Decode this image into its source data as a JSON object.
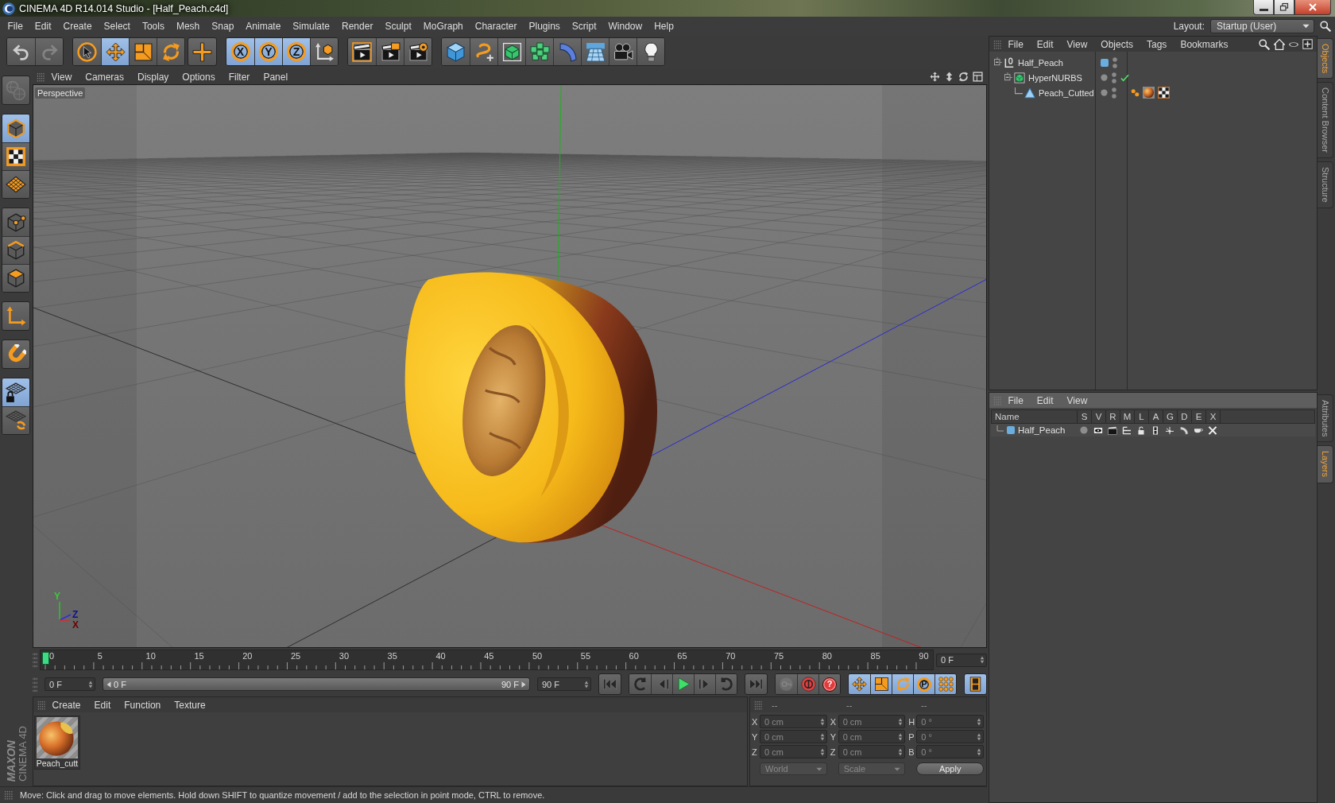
{
  "window": {
    "title": "CINEMA 4D R14.014 Studio - [Half_Peach.c4d]"
  },
  "menu_bar": [
    "File",
    "Edit",
    "Create",
    "Select",
    "Tools",
    "Mesh",
    "Snap",
    "Animate",
    "Simulate",
    "Render",
    "Sculpt",
    "MoGraph",
    "Character",
    "Plugins",
    "Script",
    "Window",
    "Help"
  ],
  "layout": {
    "label": "Layout:",
    "value": "Startup (User)"
  },
  "toolbar": [
    [
      {
        "kind": "undo",
        "selected": false,
        "disabled": false
      },
      {
        "kind": "redo",
        "selected": false,
        "disabled": true
      }
    ],
    [
      {
        "kind": "select",
        "selected": false,
        "disabled": false
      },
      {
        "kind": "move",
        "selected": true,
        "disabled": false
      },
      {
        "kind": "scale",
        "selected": false,
        "disabled": false
      },
      {
        "kind": "rotate",
        "selected": false,
        "disabled": false
      }
    ],
    [
      {
        "kind": "add",
        "selected": false,
        "disabled": false
      }
    ],
    [
      {
        "kind": "axis",
        "label": "X",
        "selected": true,
        "disabled": false
      },
      {
        "kind": "axis",
        "label": "Y",
        "selected": true,
        "disabled": false
      },
      {
        "kind": "axis",
        "label": "Z",
        "selected": true,
        "disabled": false
      },
      {
        "kind": "coords",
        "selected": false,
        "disabled": false
      }
    ],
    [
      {
        "kind": "render",
        "selected": false,
        "disabled": false
      },
      {
        "kind": "renderviewer",
        "selected": false,
        "disabled": false
      },
      {
        "kind": "rendersettings",
        "selected": false,
        "disabled": false
      }
    ],
    [
      {
        "kind": "cube",
        "selected": false,
        "disabled": false
      },
      {
        "kind": "spline",
        "selected": false,
        "disabled": false
      },
      {
        "kind": "nurbs",
        "selected": false,
        "disabled": false
      },
      {
        "kind": "cloner",
        "selected": false,
        "disabled": false
      },
      {
        "kind": "deformer",
        "selected": false,
        "disabled": false
      },
      {
        "kind": "floor",
        "selected": false,
        "disabled": false
      },
      {
        "kind": "camera",
        "selected": false,
        "disabled": false
      },
      {
        "kind": "light",
        "selected": false,
        "disabled": false
      }
    ]
  ],
  "mode_tools": [
    [
      {
        "kind": "convert",
        "selected": false,
        "disabled": true
      }
    ],
    [
      {
        "kind": "model",
        "selected": true,
        "disabled": false
      },
      {
        "kind": "texture",
        "selected": false,
        "disabled": false
      },
      {
        "kind": "workplane",
        "selected": false,
        "disabled": false
      }
    ],
    [
      {
        "kind": "points",
        "selected": false,
        "disabled": false
      },
      {
        "kind": "edges",
        "selected": false,
        "disabled": false
      },
      {
        "kind": "polygons",
        "selected": false,
        "disabled": false
      }
    ],
    [
      {
        "kind": "axismode",
        "selected": false,
        "disabled": false
      }
    ],
    [
      {
        "kind": "snap",
        "selected": false,
        "disabled": false
      }
    ],
    [
      {
        "kind": "lockplane",
        "selected": true,
        "disabled": false
      },
      {
        "kind": "planar",
        "selected": false,
        "disabled": false
      }
    ]
  ],
  "viewport": {
    "menu": [
      "View",
      "Cameras",
      "Display",
      "Options",
      "Filter",
      "Panel"
    ],
    "camera": "Perspective",
    "axis_labels": [
      {
        "text": "Y",
        "color": "#3cc83c"
      },
      {
        "text": "Z",
        "color": "#10108c"
      },
      {
        "text": "X",
        "color": "#700000"
      }
    ]
  },
  "timeline": {
    "ticks": [
      "0",
      "5",
      "10",
      "15",
      "20",
      "25",
      "30",
      "35",
      "40",
      "45",
      "50",
      "55",
      "60",
      "65",
      "70",
      "75",
      "80",
      "85",
      "90"
    ],
    "playhead": {
      "level": 0
    },
    "frame_field": "0 F"
  },
  "playback": {
    "start_field": "0 F",
    "range": {
      "start": "0 F",
      "end": "90 F",
      "level": 1
    },
    "end_field": "90 F",
    "buttons": [
      [
        {
          "kind": "start",
          "selected": false,
          "disabled": false
        }
      ],
      [
        {
          "kind": "prevkey",
          "selected": false,
          "disabled": false
        },
        {
          "kind": "prevframe",
          "selected": false,
          "disabled": false
        },
        {
          "kind": "play",
          "selected": false,
          "disabled": false
        },
        {
          "kind": "nextframe",
          "selected": false,
          "disabled": false
        },
        {
          "kind": "nextkey",
          "selected": false,
          "disabled": false
        }
      ],
      [
        {
          "kind": "end",
          "selected": false,
          "disabled": false
        }
      ],
      [
        {
          "kind": "autokey",
          "selected": false,
          "disabled": true
        },
        {
          "kind": "record",
          "selected": false,
          "disabled": false
        },
        {
          "kind": "keyinfo",
          "label": "?",
          "selected": false,
          "disabled": false
        }
      ],
      [
        {
          "kind": "keymove",
          "selected": true,
          "disabled": false
        },
        {
          "kind": "keyscale",
          "selected": true,
          "disabled": false
        },
        {
          "kind": "keyrotate",
          "selected": true,
          "disabled": false
        },
        {
          "kind": "keyparam",
          "label": "P",
          "selected": true,
          "disabled": false
        },
        {
          "kind": "keypla",
          "selected": true,
          "disabled": false
        }
      ],
      [
        {
          "kind": "timeline",
          "selected": true,
          "disabled": false
        }
      ]
    ]
  },
  "logo": {
    "brand": "MAXON",
    "product": "CINEMA 4D"
  },
  "material_manager": {
    "menu": [
      "Create",
      "Edit",
      "Function",
      "Texture"
    ],
    "materials": [
      {
        "name": "Peach_cutt"
      }
    ]
  },
  "coordinates": {
    "headers": [
      "--",
      "--",
      "--"
    ],
    "disabled": true,
    "rows": [
      [
        {
          "axis": "X",
          "value": "0 cm"
        },
        {
          "axis": "X",
          "value": "0 cm"
        },
        {
          "axis": "H",
          "value": "0 °"
        }
      ],
      [
        {
          "axis": "Y",
          "value": "0 cm"
        },
        {
          "axis": "Y",
          "value": "0 cm"
        },
        {
          "axis": "P",
          "value": "0 °"
        }
      ],
      [
        {
          "axis": "Z",
          "value": "0 cm"
        },
        {
          "axis": "Z",
          "value": "0 cm"
        },
        {
          "axis": "B",
          "value": "0 °"
        }
      ]
    ],
    "dropdowns": [
      "World",
      "Scale"
    ],
    "apply": "Apply"
  },
  "status_bar": "Move: Click and drag to move elements. Hold down SHIFT to quantize movement / add to the selection in point mode, CTRL to remove.",
  "object_manager": {
    "menu": [
      "File",
      "Edit",
      "View",
      "Objects",
      "Tags",
      "Bookmarks"
    ],
    "side_tabs": [
      {
        "label": "Objects",
        "selected": true
      },
      {
        "label": "Content Browser",
        "selected": false
      },
      {
        "label": "Structure",
        "selected": false
      }
    ],
    "objects": [
      {
        "name": "Half_Peach",
        "kind": "null",
        "color": "#6aaee0",
        "expanded": true,
        "children": [
          {
            "name": "HyperNURBS",
            "kind": "nurbs",
            "expanded": true,
            "enabled": true,
            "children": [
              {
                "name": "Peach_Cutted",
                "kind": "polygon",
                "tags": [
                  {
                    "kind": "phong"
                  },
                  {
                    "kind": "material"
                  },
                  {
                    "kind": "uvw"
                  }
                ]
              }
            ]
          }
        ]
      }
    ]
  },
  "layer_manager": {
    "menu": [
      "File",
      "Edit",
      "View"
    ],
    "side_tabs": [
      {
        "label": "Attributes",
        "selected": false
      },
      {
        "label": "Layers",
        "selected": true
      }
    ],
    "columns": [
      "Name",
      "S",
      "V",
      "R",
      "M",
      "L",
      "A",
      "G",
      "D",
      "E",
      "X"
    ],
    "layers": [
      {
        "name": "Half_Peach",
        "color": "#6aaee0",
        "flags": [
          {
            "kind": "solo",
            "on": false
          },
          {
            "kind": "view",
            "on": true
          },
          {
            "kind": "render",
            "on": true
          },
          {
            "kind": "manager",
            "on": true
          },
          {
            "kind": "lock",
            "on": true
          },
          {
            "kind": "animation",
            "on": true
          },
          {
            "kind": "generators",
            "on": true
          },
          {
            "kind": "deformers",
            "on": true
          },
          {
            "kind": "expressions",
            "on": true
          },
          {
            "kind": "xref",
            "on": true
          }
        ]
      }
    ]
  }
}
